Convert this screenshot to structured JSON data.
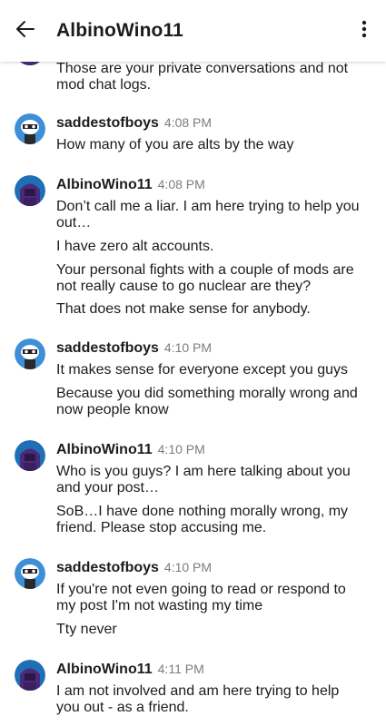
{
  "header": {
    "title": "AlbinoWino11"
  },
  "icons": {
    "back": "arrow-left-icon",
    "menu": "more-vertical-icon"
  },
  "colors": {
    "avatar_sad_bg": "#3d8fd8",
    "avatar_albino_bg": "#1e6fb5",
    "timestamp": "#7c7c7c"
  },
  "messages": [
    {
      "user": "",
      "time": "",
      "lines": [
        "Those are your private conversations and not mod chat logs."
      ]
    },
    {
      "user": "saddestofboys",
      "time": "4:08 PM",
      "lines": [
        "How many of you are alts by the way"
      ]
    },
    {
      "user": "AlbinoWino11",
      "time": "4:08 PM",
      "lines": [
        "Don’t call me a liar.  I am here trying to help you out…",
        "I have zero alt accounts.",
        "Your personal fights with a couple of mods are not really cause to go nuclear are they?",
        "That does not make sense for anybody."
      ]
    },
    {
      "user": "saddestofboys",
      "time": "4:10 PM",
      "lines": [
        "It makes sense for everyone except you guys",
        "Because you did something morally wrong and now people know"
      ]
    },
    {
      "user": "AlbinoWino11",
      "time": "4:10 PM",
      "lines": [
        "Who is you guys?  I am here talking about you and your post…",
        "SoB…I have done nothing morally wrong, my friend.  Please stop accusing me."
      ]
    },
    {
      "user": "saddestofboys",
      "time": "4:10 PM",
      "lines": [
        "If you're not even going to read or respond to my post I'm not wasting my time",
        "Tty never"
      ]
    },
    {
      "user": "AlbinoWino11",
      "time": "4:11 PM",
      "lines": [
        "I am not involved and am here trying to help you out - as a friend."
      ]
    }
  ]
}
